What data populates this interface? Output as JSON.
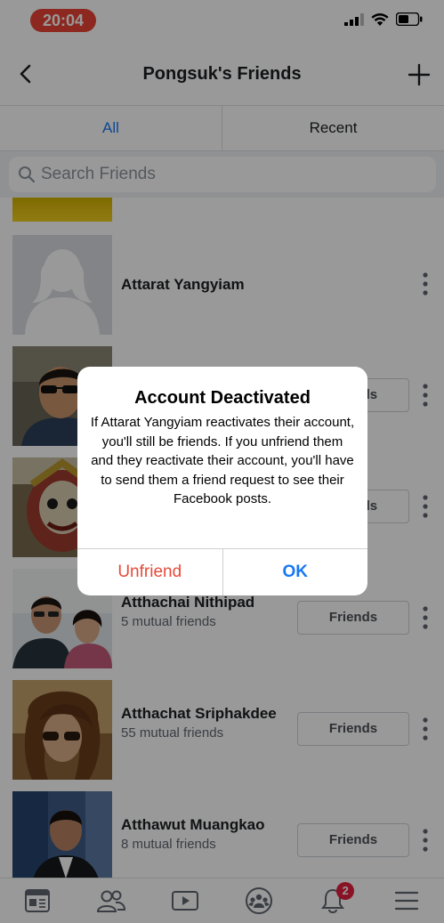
{
  "status_bar": {
    "time": "20:04"
  },
  "nav": {
    "title": "Pongsuk's Friends"
  },
  "tabs": [
    {
      "label": "All"
    },
    {
      "label": "Recent"
    }
  ],
  "search": {
    "placeholder": "Search Friends"
  },
  "friends": [
    {
      "name": "Attarat Yangyiam",
      "mutual": "",
      "button": ""
    },
    {
      "name": "",
      "mutual": "",
      "button": "Friends"
    },
    {
      "name": "",
      "mutual": "",
      "button": "Friends"
    },
    {
      "name": "Atthachai Nithipad",
      "mutual": "5 mutual friends",
      "button": "Friends"
    },
    {
      "name": "Atthachat Sriphakdee",
      "mutual": "55 mutual friends",
      "button": "Friends"
    },
    {
      "name": "Atthawut Muangkao",
      "mutual": "8 mutual friends",
      "button": "Friends"
    }
  ],
  "tab_bar": {
    "notification_badge": "2"
  },
  "dialog": {
    "title": "Account Deactivated",
    "message": "If Attarat Yangyiam reactivates their account, you'll still be friends. If you unfriend them and they reactivate their account, you'll have to send them a friend request to see their Facebook posts.",
    "unfriend_label": "Unfriend",
    "ok_label": "OK"
  },
  "colors": {
    "accent": "#1877f2",
    "destructive": "#e64a3b",
    "time_pill": "#ea4335",
    "badge": "#e41e3f"
  }
}
